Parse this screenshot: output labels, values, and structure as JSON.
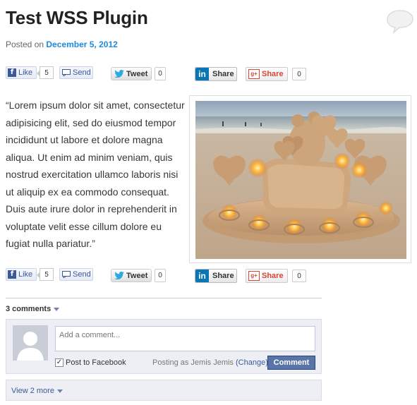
{
  "post": {
    "title": "Test WSS Plugin",
    "posted_prefix": "Posted on",
    "date": "December 5, 2012",
    "body": "“Lorem ipsum dolor sit amet, consectetur adipisicing elit, sed do eiusmod tempor incididunt ut labore et dolore magna aliqua. Ut enim ad minim veniam, quis nostrud exercitation ullamco laboris nisi ut aliquip ex ea commodo consequat. Duis aute irure dolor in reprehenderit in voluptate velit esse cillum dolore eu fugiat nulla pariatur.”"
  },
  "share_top": {
    "fb_like_label": "Like",
    "fb_like_count": "5",
    "fb_send_label": "Send",
    "tweet_label": "Tweet",
    "tweet_count": "0",
    "linkedin_label": "Share",
    "gplus_label": "Share",
    "gplus_count": "0"
  },
  "share_bottom": {
    "fb_like_label": "Like",
    "fb_like_count": "5",
    "fb_send_label": "Send",
    "tweet_label": "Tweet",
    "tweet_count": "0",
    "linkedin_label": "Share",
    "gplus_label": "Share",
    "gplus_count": "0"
  },
  "comments": {
    "count_label": "3 comments",
    "input_placeholder": "Add a comment...",
    "post_to_facebook_label": "Post to Facebook",
    "posting_as": "Posting as Jemis Jemis",
    "change_label": "(Change)",
    "comment_button": "Comment",
    "view_more": "View 2 more",
    "post_to_facebook_checked": true
  },
  "colors": {
    "link_blue": "#1b8be0",
    "facebook_blue": "#3b5998",
    "linkedin_blue": "#0a76b4",
    "gplus_red": "#d34836"
  },
  "icons": [
    "speech-bubble-icon",
    "facebook-f-icon",
    "send-icon",
    "twitter-bird-icon",
    "linkedin-in-icon",
    "google-plus-icon",
    "default-avatar-icon",
    "checkbox-checked-icon",
    "chevron-down-icon"
  ]
}
